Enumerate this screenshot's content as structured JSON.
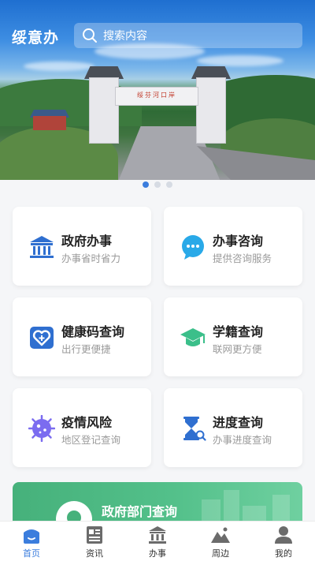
{
  "app": {
    "title": "绥意办"
  },
  "search": {
    "placeholder": "搜索内容"
  },
  "banner": {
    "gate_sign": "绥芬河口岸",
    "slides": 3,
    "active_slide": 1
  },
  "services": [
    {
      "title": "政府办事",
      "subtitle": "办事省时省力",
      "icon": "government-building-icon"
    },
    {
      "title": "办事咨询",
      "subtitle": "提供咨询服务",
      "icon": "chat-bubble-icon"
    },
    {
      "title": "健康码查询",
      "subtitle": "出行更便捷",
      "icon": "health-code-icon"
    },
    {
      "title": "学籍查询",
      "subtitle": "联网更方便",
      "icon": "graduation-cap-icon"
    },
    {
      "title": "疫情风险",
      "subtitle": "地区登记查询",
      "icon": "virus-icon"
    },
    {
      "title": "进度查询",
      "subtitle": "办事进度查询",
      "icon": "hourglass-search-icon"
    }
  ],
  "dept": {
    "title": "政府部门查询",
    "icon": "location-pin-icon"
  },
  "tabs": [
    {
      "label": "首页",
      "icon": "home-icon",
      "active": true
    },
    {
      "label": "资讯",
      "icon": "news-icon",
      "active": false
    },
    {
      "label": "办事",
      "icon": "government-building-icon",
      "active": false
    },
    {
      "label": "周边",
      "icon": "mountain-icon",
      "active": false
    },
    {
      "label": "我的",
      "icon": "user-icon",
      "active": false
    }
  ],
  "colors": {
    "accent": "#3b7ddd",
    "green": "#46b17b",
    "purple": "#7b6cf0",
    "cyan": "#29a9e8",
    "orange": "#f2a33a"
  }
}
